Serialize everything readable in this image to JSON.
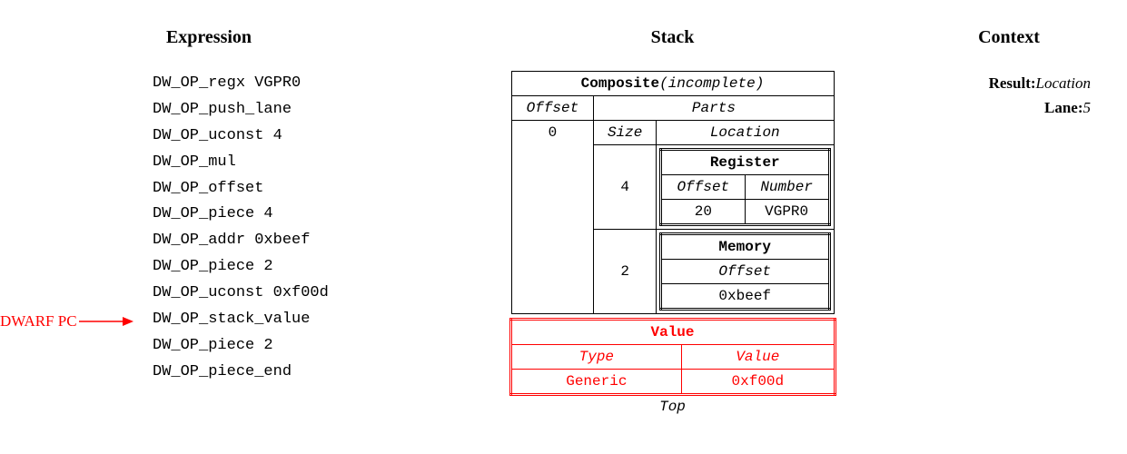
{
  "headers": {
    "expression": "Expression",
    "stack": "Stack",
    "context": "Context"
  },
  "expression": {
    "ops": [
      "DW_OP_regx VGPR0",
      "DW_OP_push_lane",
      "DW_OP_uconst 4",
      "DW_OP_mul",
      "DW_OP_offset",
      "DW_OP_piece 4",
      "DW_OP_addr 0xbeef",
      "DW_OP_piece 2",
      "DW_OP_uconst 0xf00d",
      "DW_OP_stack_value",
      "DW_OP_piece 2",
      "DW_OP_piece_end"
    ],
    "pc_index": 9,
    "pc_label": "DWARF PC"
  },
  "context": {
    "result_label": "Result:",
    "result_value": "Location",
    "lane_label": "Lane:",
    "lane_value": "5"
  },
  "stack": {
    "composite": {
      "title": "Composite",
      "status": "(incomplete)",
      "offset_hdr": "Offset",
      "parts_hdr": "Parts",
      "size_hdr": "Size",
      "location_hdr": "Location",
      "offset_value": "0",
      "parts": [
        {
          "size": "4",
          "loc_type": "Register",
          "col1_hdr": "Offset",
          "col2_hdr": "Number",
          "col1_val": "20",
          "col2_val": "VGPR0"
        },
        {
          "size": "2",
          "loc_type": "Memory",
          "col1_hdr": "Offset",
          "col2_hdr": "",
          "col1_val": "0xbeef",
          "col2_val": ""
        }
      ]
    },
    "value": {
      "title": "Value",
      "type_hdr": "Type",
      "value_hdr": "Value",
      "type_val": "Generic",
      "value_val": "0xf00d"
    },
    "top_label": "Top"
  }
}
